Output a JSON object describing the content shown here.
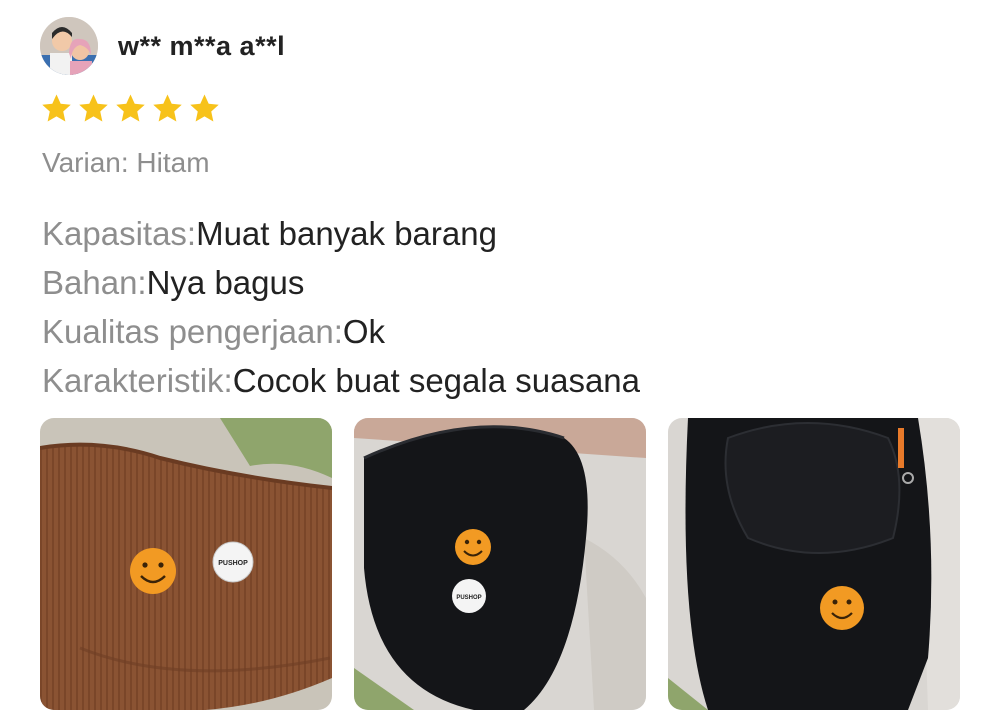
{
  "reviewer": {
    "name": "w** m**a a**l",
    "avatar_icon": "user-avatar-photo"
  },
  "rating": {
    "stars": 5,
    "max": 5,
    "color": "#f7c21a"
  },
  "variant": {
    "text": "Varian: Hitam"
  },
  "attributes": [
    {
      "label": "Kapasitas:",
      "value": "Muat banyak barang"
    },
    {
      "label": "Bahan:",
      "value": "Nya bagus"
    },
    {
      "label": "Kualitas pengerjaan:",
      "value": "Ok"
    },
    {
      "label": "Karakteristik:",
      "value": "Cocok buat segala suasana"
    }
  ],
  "photos": [
    {
      "subject": "brown-corduroy-bag-with-smiley-pin",
      "pin_text": "PUSHOP"
    },
    {
      "subject": "black-bag-with-smiley-pin",
      "pin_text": "PUSHOP"
    },
    {
      "subject": "black-bag-flap-with-smiley-pin"
    }
  ]
}
